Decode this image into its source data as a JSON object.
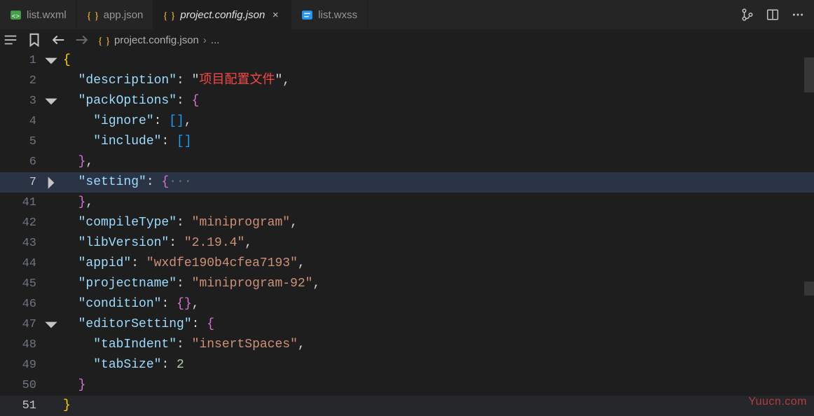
{
  "tabs": [
    {
      "label": "list.wxml",
      "icon": "wxml"
    },
    {
      "label": "app.json",
      "icon": "json"
    },
    {
      "label": "project.config.json",
      "icon": "json",
      "active": true
    },
    {
      "label": "list.wxss",
      "icon": "wxss"
    }
  ],
  "breadcrumb": {
    "file": "project.config.json",
    "rest": "..."
  },
  "lines": {
    "l1": "1",
    "l2": "2",
    "l3": "3",
    "l4": "4",
    "l5": "5",
    "l6": "6",
    "l7": "7",
    "l41": "41",
    "l42": "42",
    "l43": "43",
    "l44": "44",
    "l45": "45",
    "l46": "46",
    "l47": "47",
    "l48": "48",
    "l49": "49",
    "l50": "50",
    "l51": "51"
  },
  "code": {
    "description_key": "\"description\"",
    "description_val": "\"项目配置文件\"",
    "packOptions_key": "\"packOptions\"",
    "ignore_key": "\"ignore\"",
    "include_key": "\"include\"",
    "setting_key": "\"setting\"",
    "compileType_key": "\"compileType\"",
    "compileType_val": "\"miniprogram\"",
    "libVersion_key": "\"libVersion\"",
    "libVersion_val": "\"2.19.4\"",
    "appid_key": "\"appid\"",
    "appid_val": "\"wxdfe190b4cfea7193\"",
    "projectname_key": "\"projectname\"",
    "projectname_val": "\"miniprogram-92\"",
    "condition_key": "\"condition\"",
    "editorSetting_key": "\"editorSetting\"",
    "tabIndent_key": "\"tabIndent\"",
    "tabIndent_val": "\"insertSpaces\"",
    "tabSize_key": "\"tabSize\"",
    "tabSize_val": "2",
    "colon": ": ",
    "comma": ",",
    "lbrace": "{",
    "rbrace": "}",
    "lbracket": "[",
    "rbracket": "]",
    "empty_brackets": "[]",
    "empty_braces": "{}",
    "ellipsis": "···"
  },
  "watermark": "Yuucn.com"
}
